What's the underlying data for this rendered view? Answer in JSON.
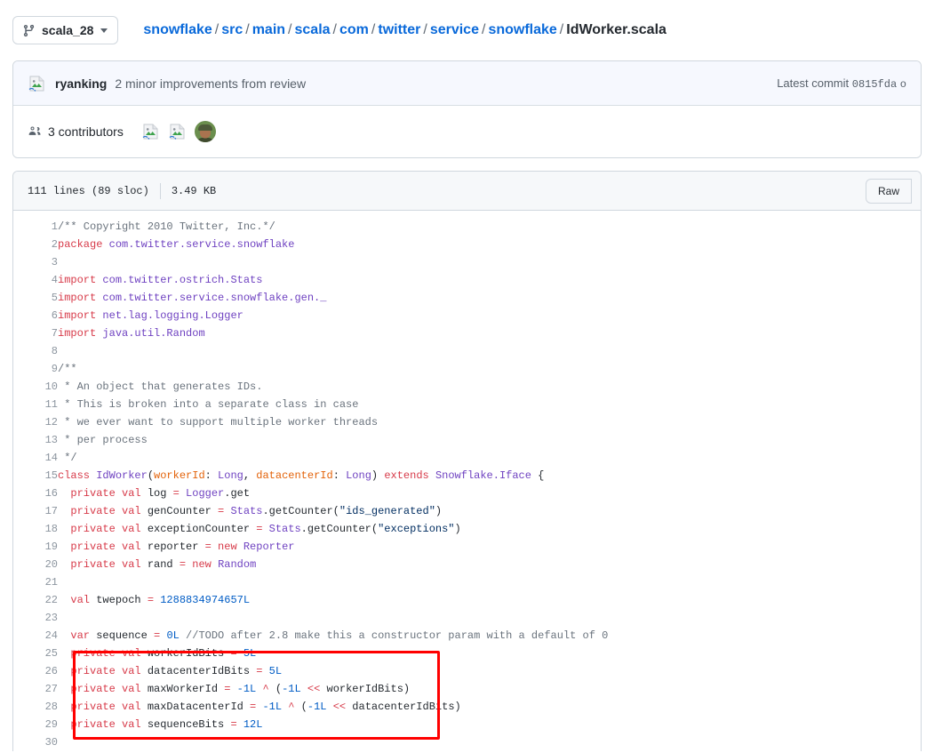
{
  "topbar": {
    "branch_button": {
      "label": "scala_28",
      "icon": "branch-icon",
      "caret": "chevron-down-icon"
    },
    "breadcrumb": {
      "links": [
        "snowflake",
        "src",
        "main",
        "scala",
        "com",
        "twitter",
        "service",
        "snowflake"
      ],
      "separator": "/",
      "current": "IdWorker.scala"
    }
  },
  "commit": {
    "author": "ryanking",
    "message": "2 minor improvements from review",
    "latest_label": "Latest commit",
    "sha": "0815fda",
    "trailing": "o",
    "avatar": "broken-image-icon"
  },
  "contributors": {
    "icon": "people-icon",
    "count": "3",
    "label": "3 contributors",
    "avatars": [
      "broken-image-icon",
      "broken-image-icon",
      "user-photo"
    ]
  },
  "file": {
    "lines_label": "111 lines (89 sloc)",
    "size_label": "3.49 KB",
    "raw_button": "Raw"
  },
  "annotation": {
    "color": "#ff0000",
    "highlighted_lines": "25-29"
  },
  "code": {
    "language": "scala",
    "lines": [
      {
        "n": "1",
        "tokens": [
          {
            "t": "/** Copyright 2010 Twitter, Inc.*/",
            "c": "c"
          }
        ]
      },
      {
        "n": "2",
        "tokens": [
          {
            "t": "package",
            "c": "k"
          },
          {
            "t": " ",
            "c": ""
          },
          {
            "t": "com.twitter.service.snowflake",
            "c": "n"
          }
        ]
      },
      {
        "n": "3",
        "tokens": []
      },
      {
        "n": "4",
        "tokens": [
          {
            "t": "import",
            "c": "k"
          },
          {
            "t": " ",
            "c": ""
          },
          {
            "t": "com.twitter.ostrich.Stats",
            "c": "n"
          }
        ]
      },
      {
        "n": "5",
        "tokens": [
          {
            "t": "import",
            "c": "k"
          },
          {
            "t": " ",
            "c": ""
          },
          {
            "t": "com.twitter.service.snowflake.gen._",
            "c": "n"
          }
        ]
      },
      {
        "n": "6",
        "tokens": [
          {
            "t": "import",
            "c": "k"
          },
          {
            "t": " ",
            "c": ""
          },
          {
            "t": "net.lag.logging.Logger",
            "c": "n"
          }
        ]
      },
      {
        "n": "7",
        "tokens": [
          {
            "t": "import",
            "c": "k"
          },
          {
            "t": " ",
            "c": ""
          },
          {
            "t": "java.util.Random",
            "c": "n"
          }
        ]
      },
      {
        "n": "8",
        "tokens": []
      },
      {
        "n": "9",
        "tokens": [
          {
            "t": "/**",
            "c": "c"
          }
        ]
      },
      {
        "n": "10",
        "tokens": [
          {
            "t": " * An object that generates IDs.",
            "c": "c"
          }
        ]
      },
      {
        "n": "11",
        "tokens": [
          {
            "t": " * This is broken into a separate class in case",
            "c": "c"
          }
        ]
      },
      {
        "n": "12",
        "tokens": [
          {
            "t": " * we ever want to support multiple worker threads",
            "c": "c"
          }
        ]
      },
      {
        "n": "13",
        "tokens": [
          {
            "t": " * per process",
            "c": "c"
          }
        ]
      },
      {
        "n": "14",
        "tokens": [
          {
            "t": " */",
            "c": "c"
          }
        ]
      },
      {
        "n": "15",
        "tokens": [
          {
            "t": "class",
            "c": "k"
          },
          {
            "t": " ",
            "c": ""
          },
          {
            "t": "IdWorker",
            "c": "n"
          },
          {
            "t": "(",
            "c": ""
          },
          {
            "t": "workerId",
            "c": "pr"
          },
          {
            "t": ": ",
            "c": ""
          },
          {
            "t": "Long",
            "c": "n"
          },
          {
            "t": ", ",
            "c": ""
          },
          {
            "t": "datacenterId",
            "c": "pr"
          },
          {
            "t": ": ",
            "c": ""
          },
          {
            "t": "Long",
            "c": "n"
          },
          {
            "t": ") ",
            "c": ""
          },
          {
            "t": "extends",
            "c": "k"
          },
          {
            "t": " ",
            "c": ""
          },
          {
            "t": "Snowflake.Iface",
            "c": "n"
          },
          {
            "t": " {",
            "c": ""
          }
        ]
      },
      {
        "n": "16",
        "tokens": [
          {
            "t": "  ",
            "c": ""
          },
          {
            "t": "private val",
            "c": "k"
          },
          {
            "t": " log ",
            "c": ""
          },
          {
            "t": "=",
            "c": "k"
          },
          {
            "t": " ",
            "c": ""
          },
          {
            "t": "Logger",
            "c": "n"
          },
          {
            "t": ".get",
            "c": ""
          }
        ]
      },
      {
        "n": "17",
        "tokens": [
          {
            "t": "  ",
            "c": ""
          },
          {
            "t": "private val",
            "c": "k"
          },
          {
            "t": " genCounter ",
            "c": ""
          },
          {
            "t": "=",
            "c": "k"
          },
          {
            "t": " ",
            "c": ""
          },
          {
            "t": "Stats",
            "c": "n"
          },
          {
            "t": ".getCounter(",
            "c": ""
          },
          {
            "t": "\"ids_generated\"",
            "c": "s"
          },
          {
            "t": ")",
            "c": ""
          }
        ]
      },
      {
        "n": "18",
        "tokens": [
          {
            "t": "  ",
            "c": ""
          },
          {
            "t": "private val",
            "c": "k"
          },
          {
            "t": " exceptionCounter ",
            "c": ""
          },
          {
            "t": "=",
            "c": "k"
          },
          {
            "t": " ",
            "c": ""
          },
          {
            "t": "Stats",
            "c": "n"
          },
          {
            "t": ".getCounter(",
            "c": ""
          },
          {
            "t": "\"exceptions\"",
            "c": "s"
          },
          {
            "t": ")",
            "c": ""
          }
        ]
      },
      {
        "n": "19",
        "tokens": [
          {
            "t": "  ",
            "c": ""
          },
          {
            "t": "private val",
            "c": "k"
          },
          {
            "t": " reporter ",
            "c": ""
          },
          {
            "t": "=",
            "c": "k"
          },
          {
            "t": " ",
            "c": ""
          },
          {
            "t": "new",
            "c": "k"
          },
          {
            "t": " ",
            "c": ""
          },
          {
            "t": "Reporter",
            "c": "n"
          }
        ]
      },
      {
        "n": "20",
        "tokens": [
          {
            "t": "  ",
            "c": ""
          },
          {
            "t": "private val",
            "c": "k"
          },
          {
            "t": " rand ",
            "c": ""
          },
          {
            "t": "=",
            "c": "k"
          },
          {
            "t": " ",
            "c": ""
          },
          {
            "t": "new",
            "c": "k"
          },
          {
            "t": " ",
            "c": ""
          },
          {
            "t": "Random",
            "c": "n"
          }
        ]
      },
      {
        "n": "21",
        "tokens": []
      },
      {
        "n": "22",
        "tokens": [
          {
            "t": "  ",
            "c": ""
          },
          {
            "t": "val",
            "c": "k"
          },
          {
            "t": " twepoch ",
            "c": ""
          },
          {
            "t": "=",
            "c": "k"
          },
          {
            "t": " ",
            "c": ""
          },
          {
            "t": "1288834974657L",
            "c": "nu"
          }
        ]
      },
      {
        "n": "23",
        "tokens": []
      },
      {
        "n": "24",
        "tokens": [
          {
            "t": "  ",
            "c": ""
          },
          {
            "t": "var",
            "c": "k"
          },
          {
            "t": " sequence ",
            "c": ""
          },
          {
            "t": "=",
            "c": "k"
          },
          {
            "t": " ",
            "c": ""
          },
          {
            "t": "0L",
            "c": "nu"
          },
          {
            "t": " ",
            "c": ""
          },
          {
            "t": "//TODO after 2.8 make this a constructor param with a default of 0",
            "c": "c"
          }
        ]
      },
      {
        "n": "25",
        "tokens": [
          {
            "t": "  ",
            "c": ""
          },
          {
            "t": "private val",
            "c": "k"
          },
          {
            "t": " workerIdBits ",
            "c": ""
          },
          {
            "t": "=",
            "c": "k"
          },
          {
            "t": " ",
            "c": ""
          },
          {
            "t": "5L",
            "c": "nu"
          }
        ]
      },
      {
        "n": "26",
        "tokens": [
          {
            "t": "  ",
            "c": ""
          },
          {
            "t": "private val",
            "c": "k"
          },
          {
            "t": " datacenterIdBits ",
            "c": ""
          },
          {
            "t": "=",
            "c": "k"
          },
          {
            "t": " ",
            "c": ""
          },
          {
            "t": "5L",
            "c": "nu"
          }
        ]
      },
      {
        "n": "27",
        "tokens": [
          {
            "t": "  ",
            "c": ""
          },
          {
            "t": "private val",
            "c": "k"
          },
          {
            "t": " maxWorkerId ",
            "c": ""
          },
          {
            "t": "=",
            "c": "k"
          },
          {
            "t": " ",
            "c": ""
          },
          {
            "t": "-1L",
            "c": "nu"
          },
          {
            "t": " ",
            "c": ""
          },
          {
            "t": "^",
            "c": "k"
          },
          {
            "t": " (",
            "c": ""
          },
          {
            "t": "-1L",
            "c": "nu"
          },
          {
            "t": " ",
            "c": ""
          },
          {
            "t": "<<",
            "c": "k"
          },
          {
            "t": " workerIdBits)",
            "c": ""
          }
        ]
      },
      {
        "n": "28",
        "tokens": [
          {
            "t": "  ",
            "c": ""
          },
          {
            "t": "private val",
            "c": "k"
          },
          {
            "t": " maxDatacenterId ",
            "c": ""
          },
          {
            "t": "=",
            "c": "k"
          },
          {
            "t": " ",
            "c": ""
          },
          {
            "t": "-1L",
            "c": "nu"
          },
          {
            "t": " ",
            "c": ""
          },
          {
            "t": "^",
            "c": "k"
          },
          {
            "t": " (",
            "c": ""
          },
          {
            "t": "-1L",
            "c": "nu"
          },
          {
            "t": " ",
            "c": ""
          },
          {
            "t": "<<",
            "c": "k"
          },
          {
            "t": " datacenterIdBits)",
            "c": ""
          }
        ]
      },
      {
        "n": "29",
        "tokens": [
          {
            "t": "  ",
            "c": ""
          },
          {
            "t": "private val",
            "c": "k"
          },
          {
            "t": " sequenceBits ",
            "c": ""
          },
          {
            "t": "=",
            "c": "k"
          },
          {
            "t": " ",
            "c": ""
          },
          {
            "t": "12L",
            "c": "nu"
          }
        ]
      },
      {
        "n": "30",
        "tokens": []
      }
    ]
  }
}
